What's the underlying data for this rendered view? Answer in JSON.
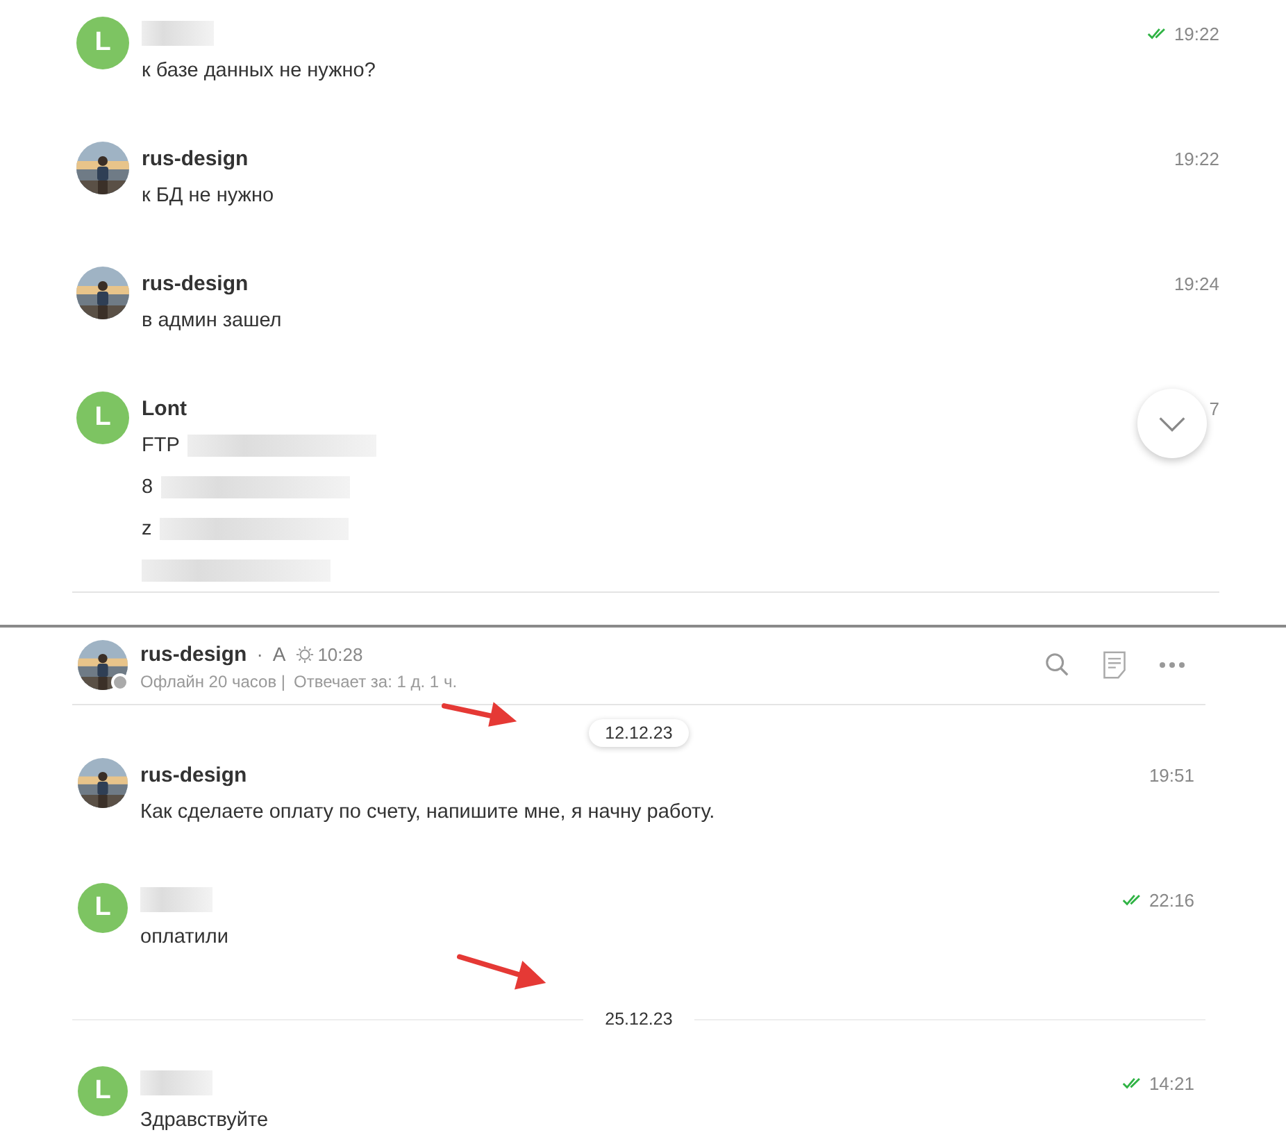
{
  "top_chat": {
    "messages": [
      {
        "avatar": {
          "kind": "letter",
          "letter": "L"
        },
        "author_redacted": true,
        "time": "19:22",
        "read": true,
        "lines": [
          {
            "text": "к базе данных не нужно?"
          }
        ]
      },
      {
        "author": "rus-design",
        "time": "19:22",
        "lines": [
          {
            "text": "к БД не нужно"
          }
        ]
      },
      {
        "author": "rus-design",
        "time": "19:24",
        "lines": [
          {
            "text": "в админ зашел"
          }
        ]
      },
      {
        "avatar": {
          "kind": "letter",
          "letter": "L"
        },
        "author": "Lont",
        "time": "7",
        "lines": [
          {
            "text": "FTP",
            "redacted": true
          },
          {
            "text": "8",
            "redacted": true
          },
          {
            "text": "z",
            "redacted": true
          },
          {
            "redacted": true
          }
        ]
      }
    ]
  },
  "bottom_chat": {
    "header": {
      "name": "rus-design",
      "separator": "·",
      "mark": "A",
      "local_time": "10:28",
      "online": false,
      "status": "Офлайн 20 часов |",
      "response_time": "Отвечает за: 1 д. 1 ч."
    },
    "items": [
      {
        "kind": "date_pill",
        "date": "12.12.23"
      },
      {
        "kind": "message",
        "author": "rus-design",
        "time": "19:51",
        "lines": [
          {
            "text": "Как сделаете оплату по счету, напишите мне, я начну работу."
          }
        ]
      },
      {
        "kind": "message",
        "avatar": {
          "kind": "letter",
          "letter": "L"
        },
        "author_redacted": true,
        "time": "22:16",
        "read": true,
        "lines": [
          {
            "text": "оплатили"
          }
        ]
      },
      {
        "kind": "date_line",
        "date": "25.12.23"
      },
      {
        "kind": "message",
        "avatar": {
          "kind": "letter",
          "letter": "L"
        },
        "author_redacted": true,
        "time": "14:21",
        "read": true,
        "lines": [
          {
            "text": "Здравствуйте"
          }
        ]
      }
    ]
  }
}
